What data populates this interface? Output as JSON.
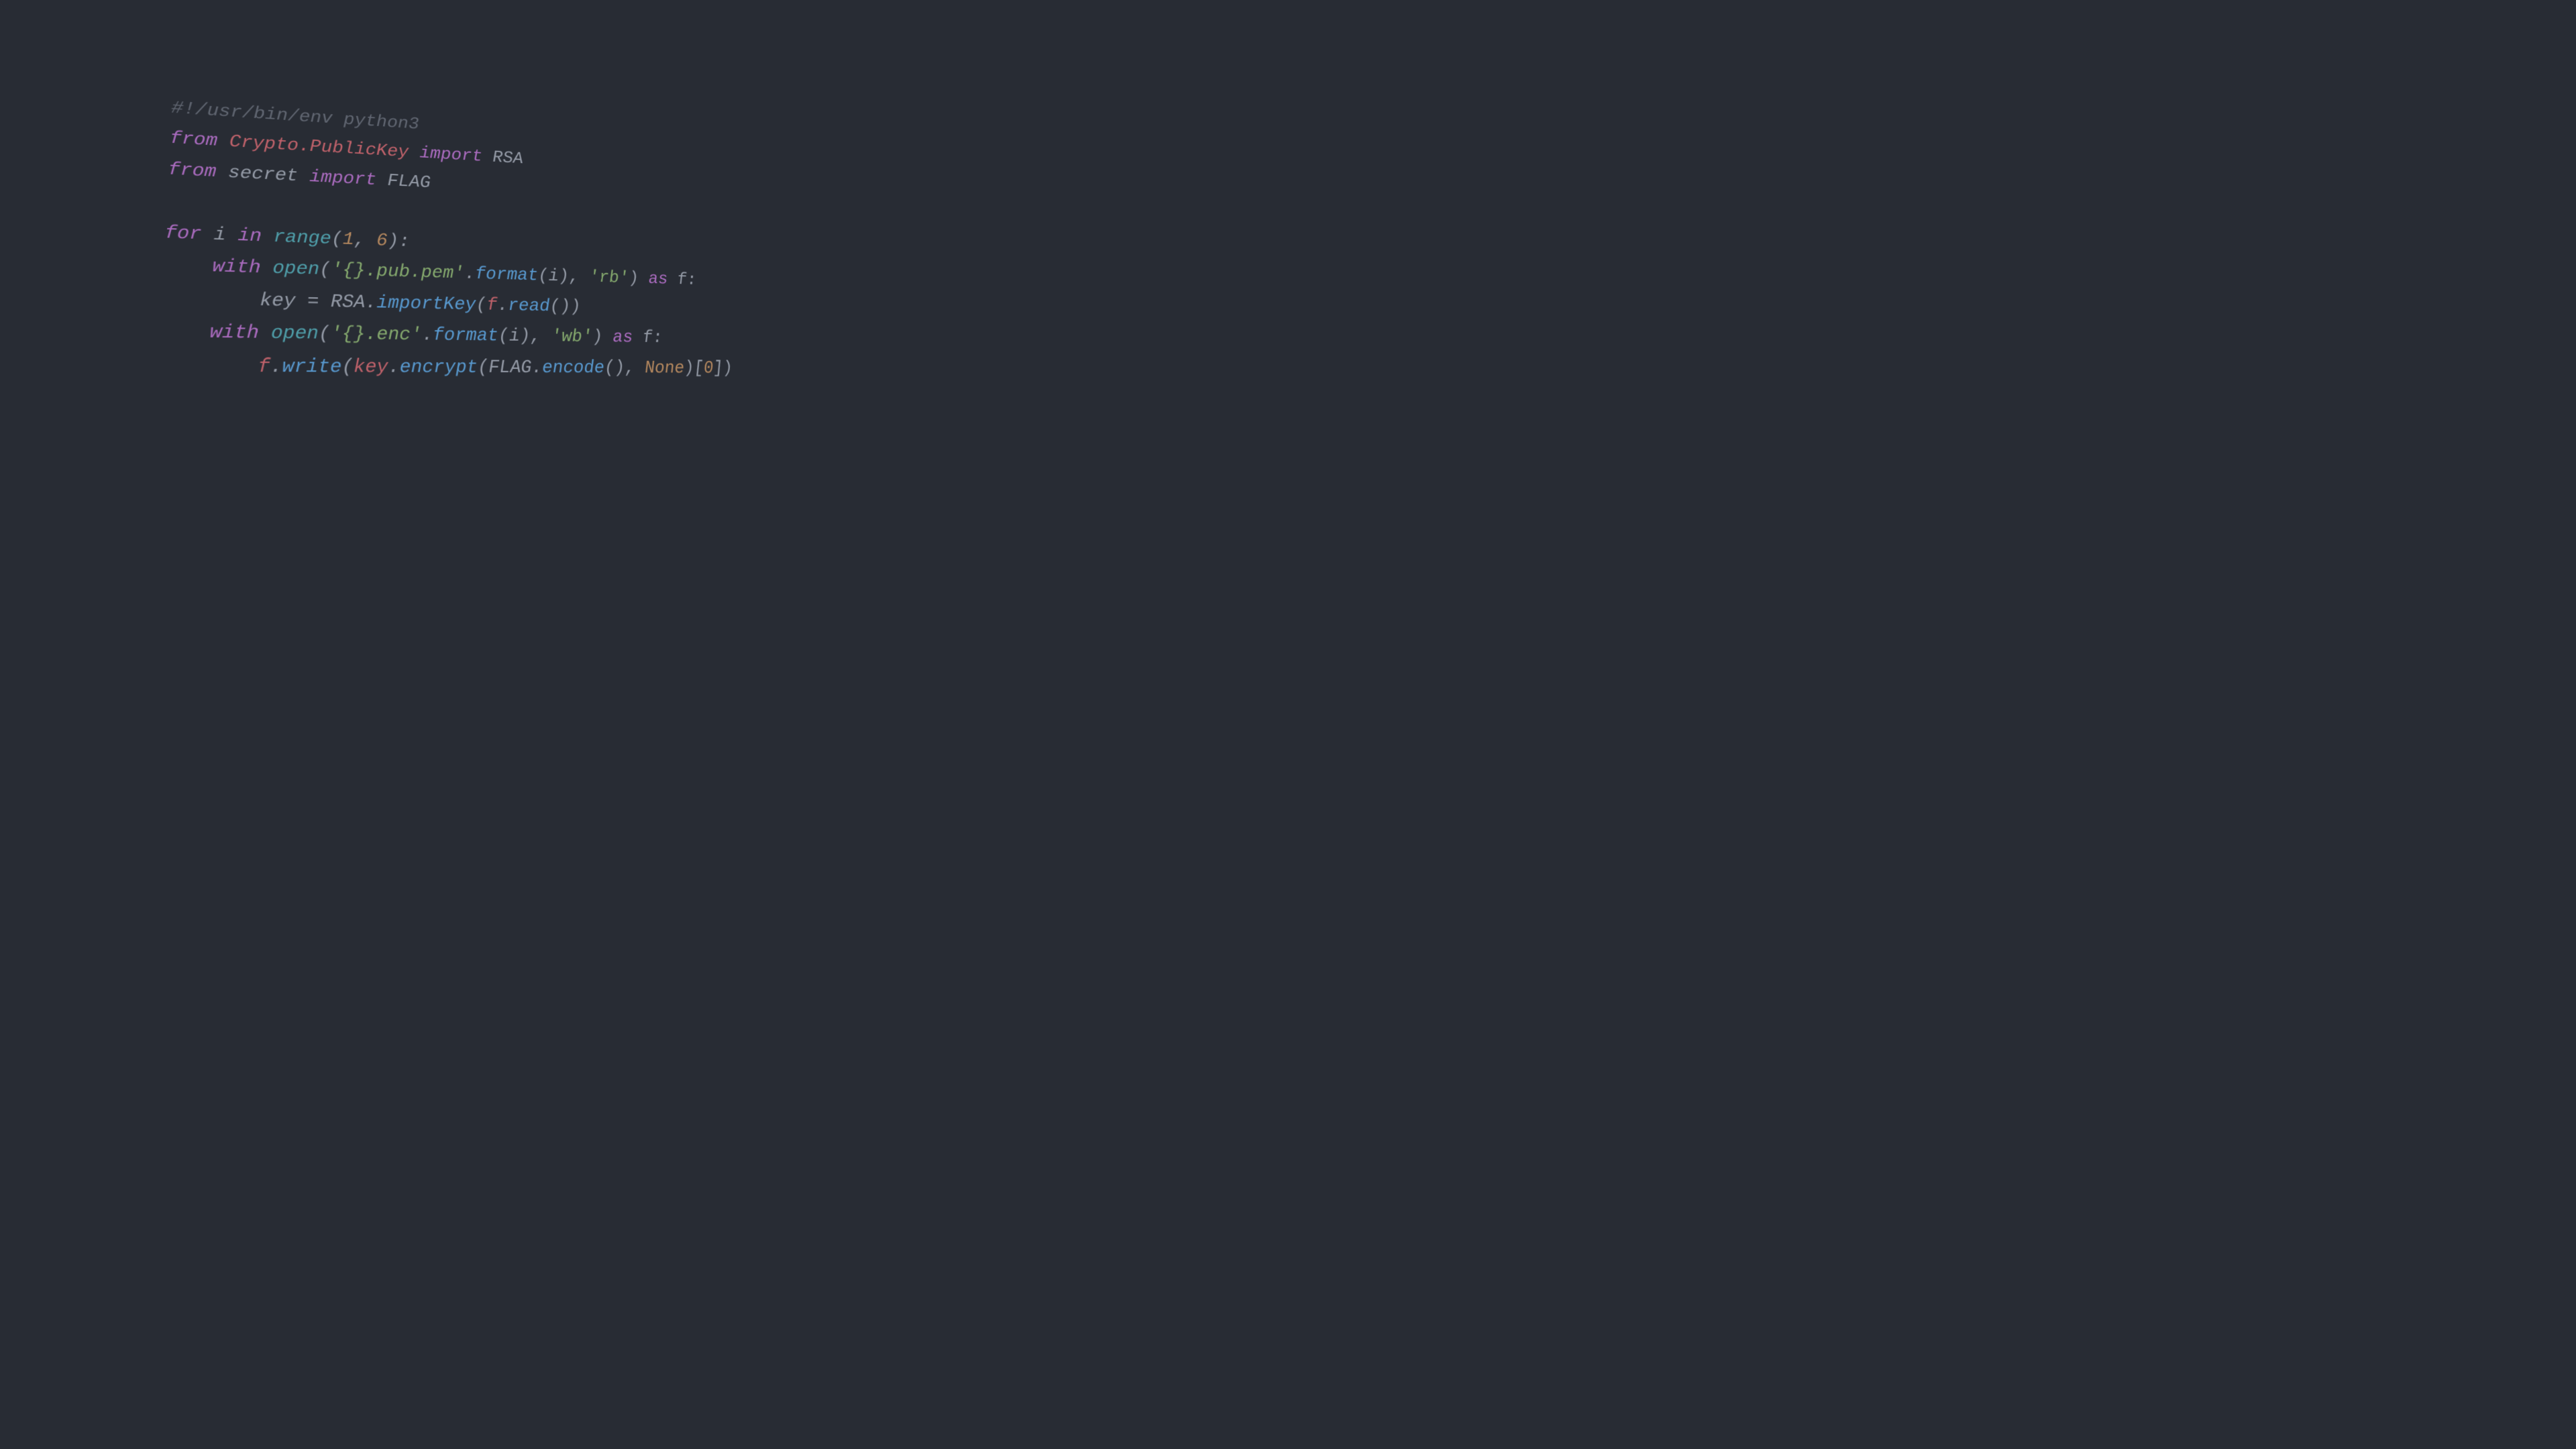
{
  "code": {
    "shebang": "#!/usr/bin/env python3",
    "kw_from": "from",
    "kw_import": "import",
    "mod_crypto": "Crypto.PublicKey",
    "cls_rsa": "RSA",
    "mod_secret": "secret",
    "cls_flag": "FLAG",
    "kw_for": "for",
    "var_i": "i",
    "kw_in": "in",
    "fn_range": "range",
    "num_1": "1",
    "num_6": "6",
    "kw_with": "with",
    "fn_open": "open",
    "str_pub_pem": "'{}.pub.pem'",
    "fn_format": "format",
    "str_rb": "'rb'",
    "kw_as": "as",
    "var_f": "f",
    "var_key": "key",
    "fn_importKey": "importKey",
    "fn_read": "read",
    "str_enc": "'{}.enc'",
    "str_wb": "'wb'",
    "fn_write": "write",
    "fn_encrypt": "encrypt",
    "fn_encode": "encode",
    "const_none": "None",
    "num_0": "0",
    "eq": " = ",
    "dot": ".",
    "comma_sp": ", ",
    "lparen": "(",
    "rparen": ")",
    "colon": ":",
    "lbrack": "[",
    "rbrack": "]"
  }
}
